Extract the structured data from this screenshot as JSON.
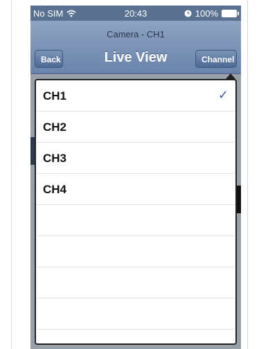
{
  "status_bar": {
    "carrier": "No SIM",
    "time": "20:43",
    "battery": "100%"
  },
  "nav": {
    "subtitle": "Camera - CH1",
    "title": "Live View",
    "back_label": "Back",
    "channel_label": "Channel"
  },
  "channels": [
    {
      "label": "CH1",
      "selected": true
    },
    {
      "label": "CH2",
      "selected": false
    },
    {
      "label": "CH3",
      "selected": false
    },
    {
      "label": "CH4",
      "selected": false
    }
  ],
  "colors": {
    "nav_bar": "#6a84ab",
    "checkmark": "#3b5ea7"
  }
}
